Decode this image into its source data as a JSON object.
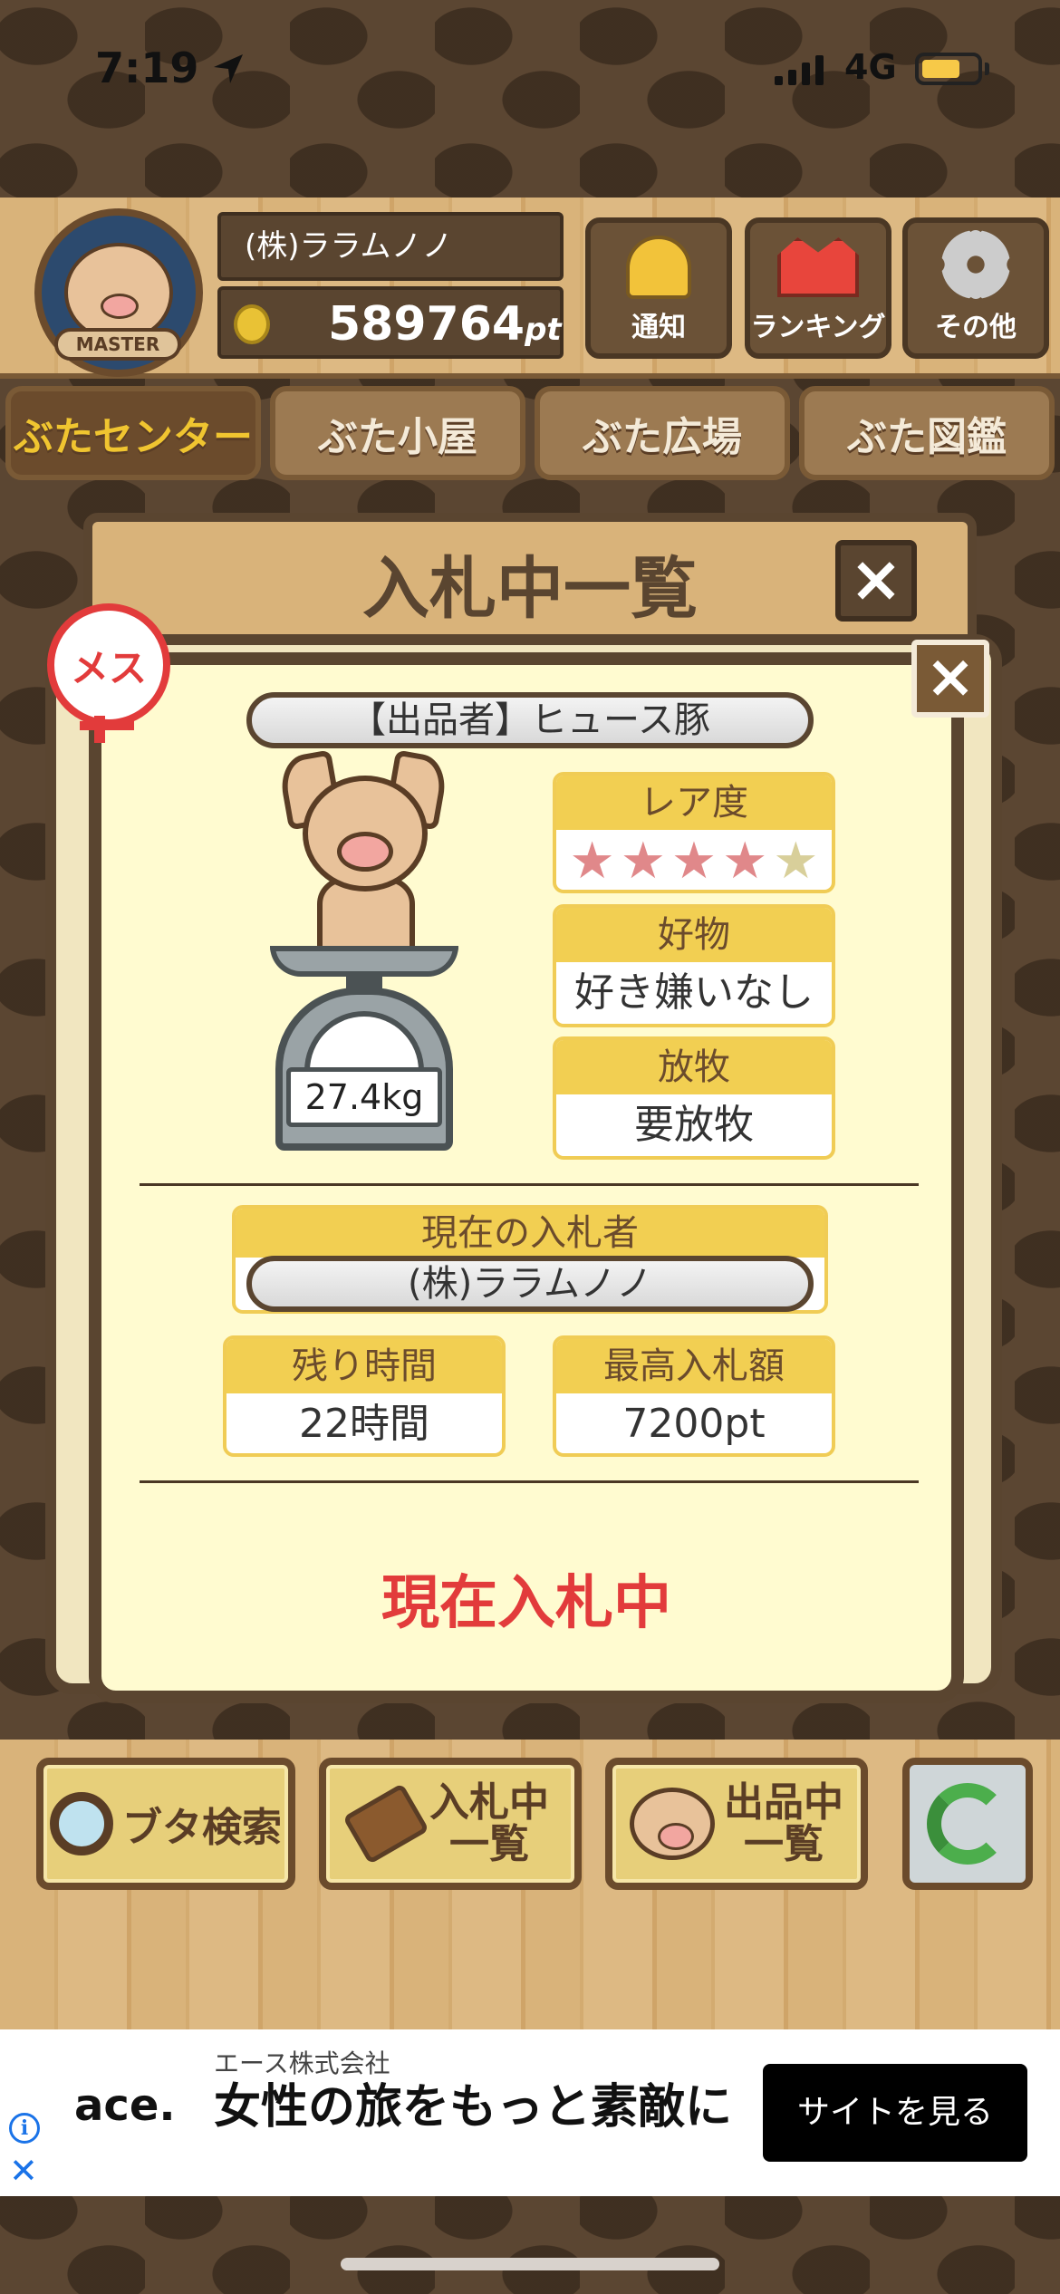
{
  "status_bar": {
    "time": "7:19",
    "network": "4G"
  },
  "header": {
    "badge_text": "MASTER",
    "company_name": "(株)ララムノノ",
    "points": "589764",
    "points_unit": "pt",
    "buttons": [
      {
        "label": "通知",
        "icon": "bell-icon"
      },
      {
        "label": "ランキング",
        "icon": "crown-icon"
      },
      {
        "label": "その他",
        "icon": "gear-icon"
      }
    ]
  },
  "nav_tabs": [
    {
      "label": "ぶたセンター",
      "active": true
    },
    {
      "label": "ぶた小屋",
      "active": false
    },
    {
      "label": "ぶた広場",
      "active": false
    },
    {
      "label": "ぶた図鑑",
      "active": false
    }
  ],
  "bid_list_panel": {
    "title": "入札中一覧",
    "close_label": "×"
  },
  "modal": {
    "close_label": "×",
    "gender_label": "メス",
    "seller": "【出品者】ヒュース豚",
    "weight": "27.4kg",
    "rarity": {
      "label": "レア度",
      "stars_filled": 4,
      "stars_total": 5
    },
    "favorite": {
      "label": "好物",
      "value": "好き嫌いなし"
    },
    "grazing": {
      "label": "放牧",
      "value": "要放牧"
    },
    "current_bidder": {
      "label": "現在の入札者",
      "value": "(株)ララムノノ"
    },
    "remaining_time": {
      "label": "残り時間",
      "value": "22時間"
    },
    "highest_bid": {
      "label": "最高入札額",
      "value": "7200pt"
    },
    "status": "現在入札中"
  },
  "bottom_bar": {
    "search": "ブタ検索",
    "bidding_line1": "入札中",
    "bidding_line2": "一覧",
    "listing_line1": "出品中",
    "listing_line2": "一覧"
  },
  "ad": {
    "brand": "ace.",
    "company": "エース株式会社",
    "headline": "女性の旅をもっと素敵に",
    "cta": "サイトを見る"
  }
}
